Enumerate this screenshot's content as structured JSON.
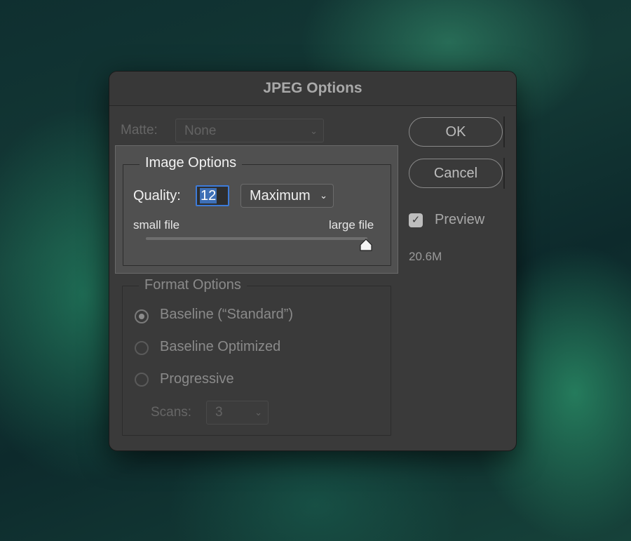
{
  "dialog": {
    "title": "JPEG Options"
  },
  "matte": {
    "label": "Matte:",
    "value": "None"
  },
  "image_options": {
    "title": "Image Options",
    "quality_label": "Quality:",
    "quality_value": "12",
    "quality_preset": "Maximum",
    "small_file_label": "small file",
    "large_file_label": "large file",
    "slider_fraction": 1.0
  },
  "format_options": {
    "title": "Format Options",
    "radios": [
      {
        "label": "Baseline (“Standard”)",
        "checked": true
      },
      {
        "label": "Baseline Optimized",
        "checked": false
      },
      {
        "label": "Progressive",
        "checked": false
      }
    ],
    "scans_label": "Scans:",
    "scans_value": "3"
  },
  "buttons": {
    "ok": "OK",
    "cancel": "Cancel"
  },
  "preview": {
    "label": "Preview",
    "checked": true,
    "file_size": "20.6M"
  },
  "icons": {
    "checkbox": "checkmark-icon",
    "dropdown": "chevron-down-icon",
    "slider_thumb": "slider-thumb-icon"
  }
}
